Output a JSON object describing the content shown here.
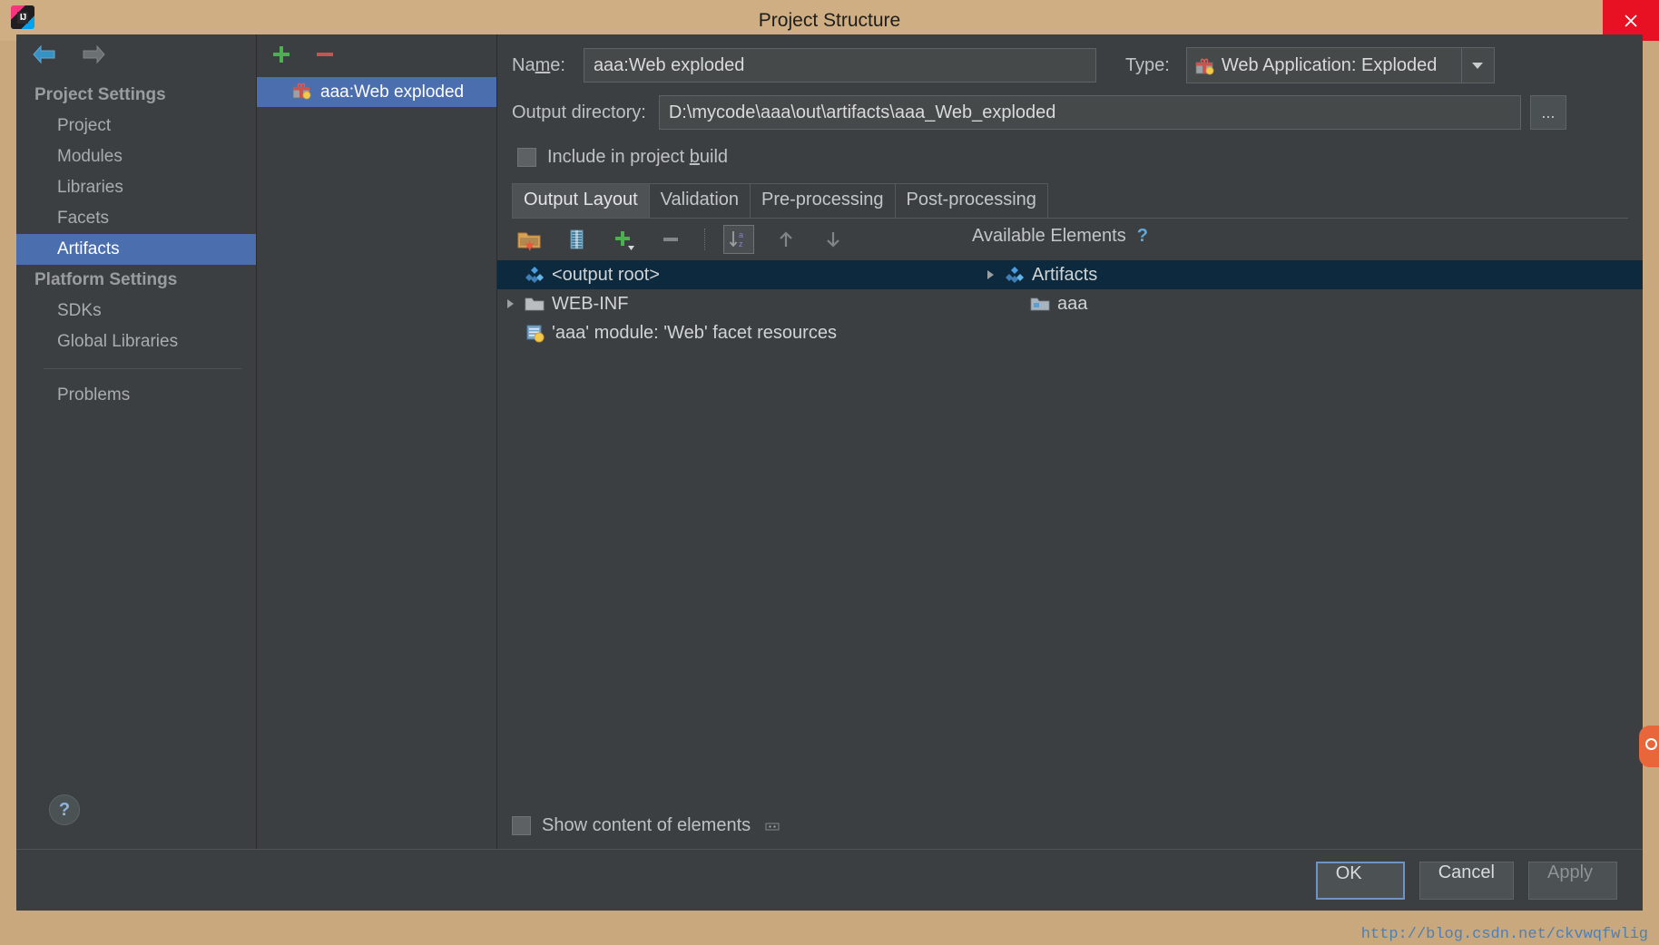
{
  "window": {
    "title": "Project Structure",
    "app_icon": "intellij-idea-icon",
    "close_label": "✕",
    "titlebar_color": "#cfae83",
    "accent_selection": "#4b6eaf",
    "tree_selection": "#0d293e"
  },
  "sidebar": {
    "back_icon": "back-arrow-icon",
    "forward_icon": "forward-arrow-icon",
    "groups": [
      {
        "label": "Project Settings",
        "items": [
          {
            "label": "Project",
            "selected": false
          },
          {
            "label": "Modules",
            "selected": false
          },
          {
            "label": "Libraries",
            "selected": false
          },
          {
            "label": "Facets",
            "selected": false
          },
          {
            "label": "Artifacts",
            "selected": true
          }
        ]
      },
      {
        "label": "Platform Settings",
        "items": [
          {
            "label": "SDKs",
            "selected": false
          },
          {
            "label": "Global Libraries",
            "selected": false
          }
        ]
      }
    ],
    "problems": {
      "label": "Problems"
    },
    "help_label": "?"
  },
  "artifacts_panel": {
    "add_label": "+",
    "remove_label": "−",
    "items": [
      {
        "label": "aaa:Web exploded",
        "icon": "artifact-package-icon",
        "selected": true
      }
    ]
  },
  "form": {
    "name_label_pre": "Na",
    "name_label_mnem": "m",
    "name_label_post": "e:",
    "name_value": "aaa:Web exploded",
    "type_label": "Type:",
    "type_value": "Web Application: Exploded",
    "type_icon": "artifact-package-icon",
    "output_dir_label": "Output directory:",
    "output_dir_value": "D:\\mycode\\aaa\\out\\artifacts\\aaa_Web_exploded",
    "browse_label": "...",
    "include_label_pre": "Include in project ",
    "include_label_mnem": "b",
    "include_label_post": "uild",
    "include_checked": false
  },
  "tabs": [
    {
      "label": "Output Layout",
      "active": true
    },
    {
      "label": "Validation",
      "active": false
    },
    {
      "label": "Pre-processing",
      "active": false
    },
    {
      "label": "Post-processing",
      "active": false
    }
  ],
  "toolbar": [
    {
      "name": "create-directory-icon",
      "title": "Create Directory"
    },
    {
      "name": "create-archive-icon",
      "title": "Create Archive"
    },
    {
      "name": "add-copy-icon",
      "title": "Add Copy of"
    },
    {
      "name": "remove-icon",
      "title": "Remove"
    },
    {
      "name": "sort-az-icon",
      "title": "Sort by Name",
      "framed": true
    },
    {
      "name": "move-up-icon",
      "title": "Move Up"
    },
    {
      "name": "move-down-icon",
      "title": "Move Down"
    }
  ],
  "available_elements": {
    "title": "Available Elements",
    "help_label": "?",
    "tree": [
      {
        "label": "Artifacts",
        "icon": "artifacts-diamond-icon",
        "expandable": true,
        "expanded": false,
        "indent": 0,
        "selected": true
      },
      {
        "label": "aaa",
        "icon": "module-folder-icon",
        "expandable": false,
        "indent": 1,
        "selected": false
      }
    ]
  },
  "output_tree": [
    {
      "label": "<output root>",
      "icon": "artifacts-diamond-icon",
      "expandable": false,
      "indent": 0,
      "selected": true
    },
    {
      "label": "WEB-INF",
      "icon": "folder-icon",
      "expandable": true,
      "expanded": false,
      "indent": 1,
      "selected": false
    },
    {
      "label": "'aaa' module: 'Web' facet resources",
      "icon": "web-facet-resources-icon",
      "expandable": false,
      "indent": 1,
      "selected": false
    }
  ],
  "footer": {
    "show_content_label": "Show content of elements",
    "show_content_checked": false,
    "dots_label": "∙∙"
  },
  "buttons": [
    {
      "label": "OK",
      "style": "default"
    },
    {
      "label": "Cancel",
      "style": "normal"
    },
    {
      "label": "Apply",
      "style": "disabled"
    }
  ],
  "watermark": "http://blog.csdn.net/ckvwqfwlig"
}
